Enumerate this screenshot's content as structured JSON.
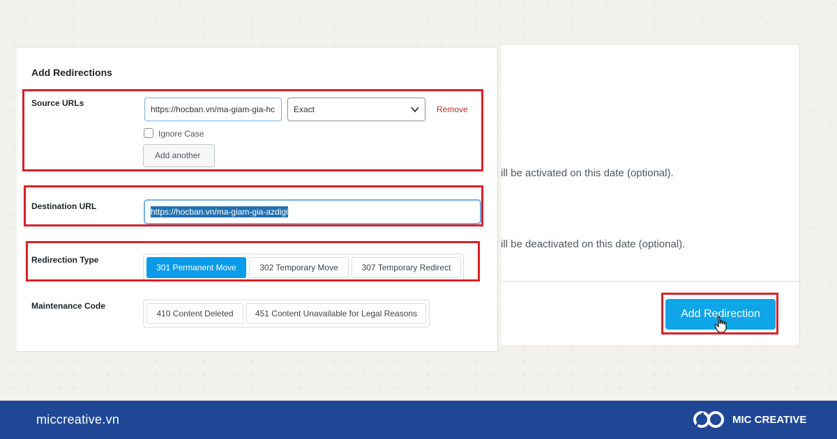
{
  "form": {
    "title": "Add Redirections",
    "source": {
      "label": "Source URLs",
      "url_value": "https://hocban.vn/ma-giam-gia-hc",
      "match_selected": "Exact",
      "remove_label": "Remove",
      "ignore_case_label": "Ignore Case",
      "ignore_case_checked": false,
      "add_another_label": "Add another"
    },
    "destination": {
      "label": "Destination URL",
      "url_value": "https://hocban.vn/ma-giam-gia-azdigi"
    },
    "redirection_type": {
      "label": "Redirection Type",
      "options": [
        "301 Permanent Move",
        "302 Temporary Move",
        "307 Temporary Redirect"
      ],
      "selected": "301 Permanent Move"
    },
    "maintenance_code": {
      "label": "Maintenance Code",
      "options": [
        "410 Content Deleted",
        "451 Content Unavailable for Legal Reasons"
      ]
    }
  },
  "side_panel": {
    "activation_hint": "ill be activated on this date (optional).",
    "deactivation_hint": "ill be deactivated on this date (optional).",
    "submit_label": "Add Redirection"
  },
  "footer": {
    "site": "miccreative.vn",
    "brand": "MIC CREATIVE"
  },
  "colors": {
    "primary_button": "#0ea5e9",
    "active_segment": "#0b9be8",
    "highlight_border": "#d92027",
    "footer_bar": "#1f4796",
    "remove_link": "#b32d2e"
  },
  "icons": {
    "select_arrow": "chevron-down-icon",
    "pointer": "hand-cursor-icon",
    "logo": "mic-creative-logo-icon"
  }
}
